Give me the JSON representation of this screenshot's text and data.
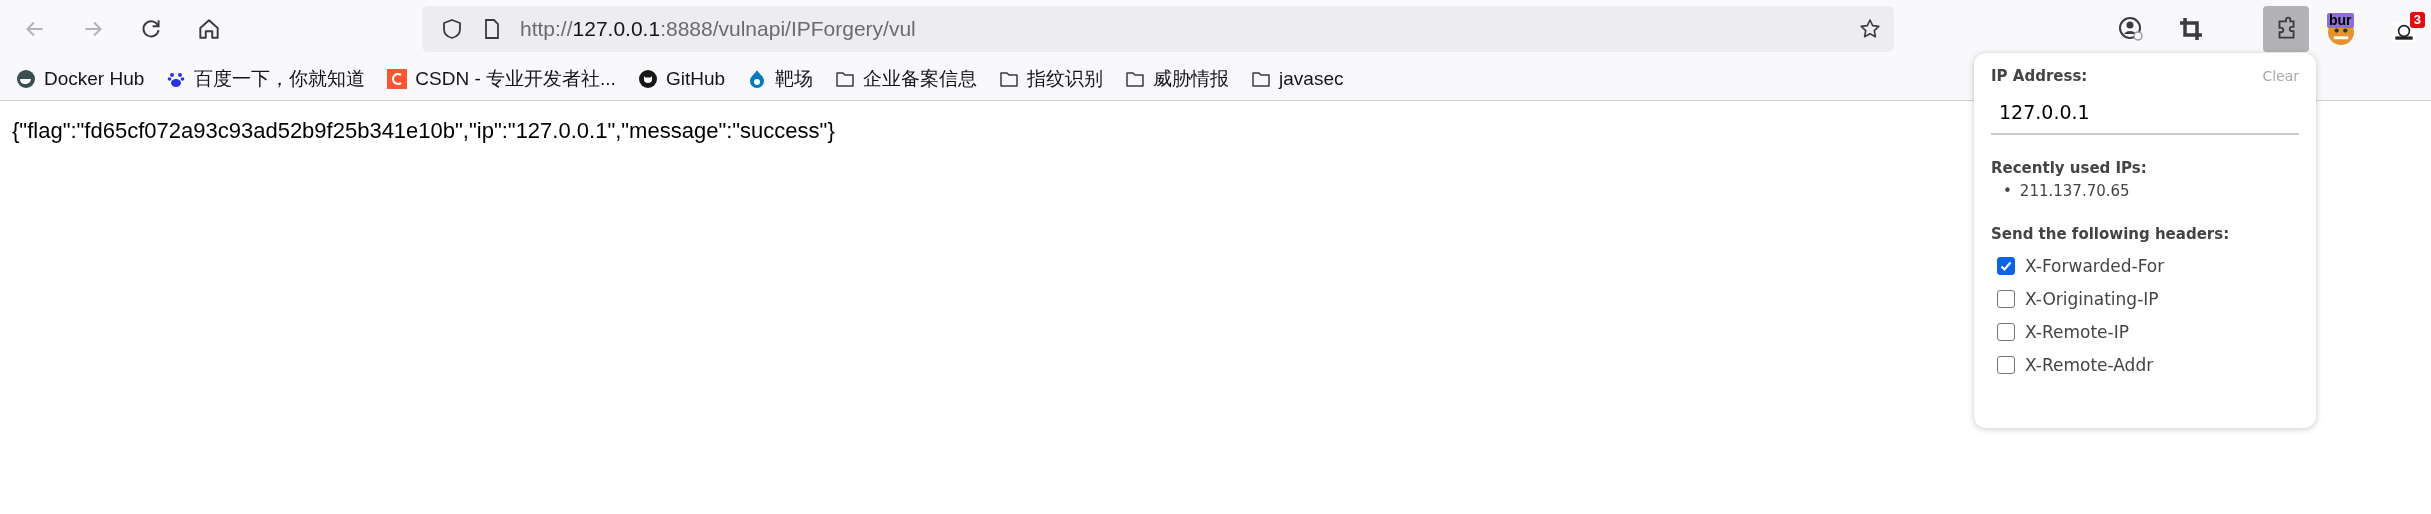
{
  "url": {
    "scheme": "http://",
    "host": "127.0.0.1",
    "path": ":8888/vulnapi/IPForgery/vul"
  },
  "extensions": [
    {
      "kind": "profile"
    },
    {
      "kind": "crop"
    },
    {
      "kind": "puzzle",
      "selected": true
    },
    {
      "kind": "bur",
      "label": "bur"
    },
    {
      "kind": "badge",
      "badge": "3"
    }
  ],
  "bookmarks": [
    {
      "kind": "docker",
      "label": "Docker Hub"
    },
    {
      "kind": "baidu",
      "label": "百度一下，你就知道"
    },
    {
      "kind": "csdn",
      "label": "CSDN - 专业开发者社..."
    },
    {
      "kind": "github",
      "label": "GitHub"
    },
    {
      "kind": "drupal",
      "label": "靶场"
    },
    {
      "kind": "folder",
      "label": "企业备案信息"
    },
    {
      "kind": "folder",
      "label": "指纹识别"
    },
    {
      "kind": "folder",
      "label": "威胁情报"
    },
    {
      "kind": "folder",
      "label": "javasec"
    }
  ],
  "body_text": "{\"flag\":\"fd65cf072a93c93ad52b9f25b341e10b\",\"ip\":\"127.0.0.1\",\"message\":\"success\"}",
  "popup": {
    "ip_label": "IP Address:",
    "clear": "Clear",
    "ip_value": "127.0.0.1",
    "recent_title": "Recently used IPs:",
    "recent": [
      {
        "marker": "•",
        "ip": "211.137.70.65"
      }
    ],
    "headers_title": "Send the following headers:",
    "headers": [
      {
        "label": "X-Forwarded-For",
        "checked": true
      },
      {
        "label": "X-Originating-IP",
        "checked": false
      },
      {
        "label": "X-Remote-IP",
        "checked": false
      },
      {
        "label": "X-Remote-Addr",
        "checked": false
      }
    ]
  }
}
